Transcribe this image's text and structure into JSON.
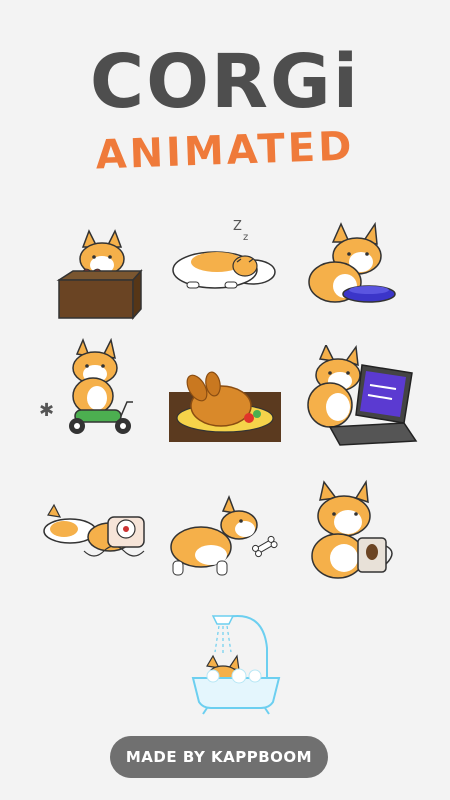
{
  "header": {
    "title": "CORGi",
    "subtitle": "ANIMATED"
  },
  "stickers": [
    {
      "icon": "corgi-in-box-with-heart-icon"
    },
    {
      "icon": "corgi-sleeping-on-pillow-icon"
    },
    {
      "icon": "corgi-with-food-bowl-icon"
    },
    {
      "icon": "corgi-on-scooter-icon"
    },
    {
      "icon": "roast-turkey-icon"
    },
    {
      "icon": "corgi-with-laptop-icon"
    },
    {
      "icon": "corgi-with-telephone-icon"
    },
    {
      "icon": "corgi-with-bone-icon"
    },
    {
      "icon": "corgi-with-coffee-mug-icon"
    },
    {
      "icon": "corgi-in-bathtub-icon"
    }
  ],
  "footer": {
    "made_by": "MADE BY KAPPBOOM"
  },
  "colors": {
    "title": "#4e4e4e",
    "subtitle": "#ef7a3a",
    "corgi_orange": "#f5b04a",
    "background": "#f3f3f3",
    "button": "#707070"
  }
}
